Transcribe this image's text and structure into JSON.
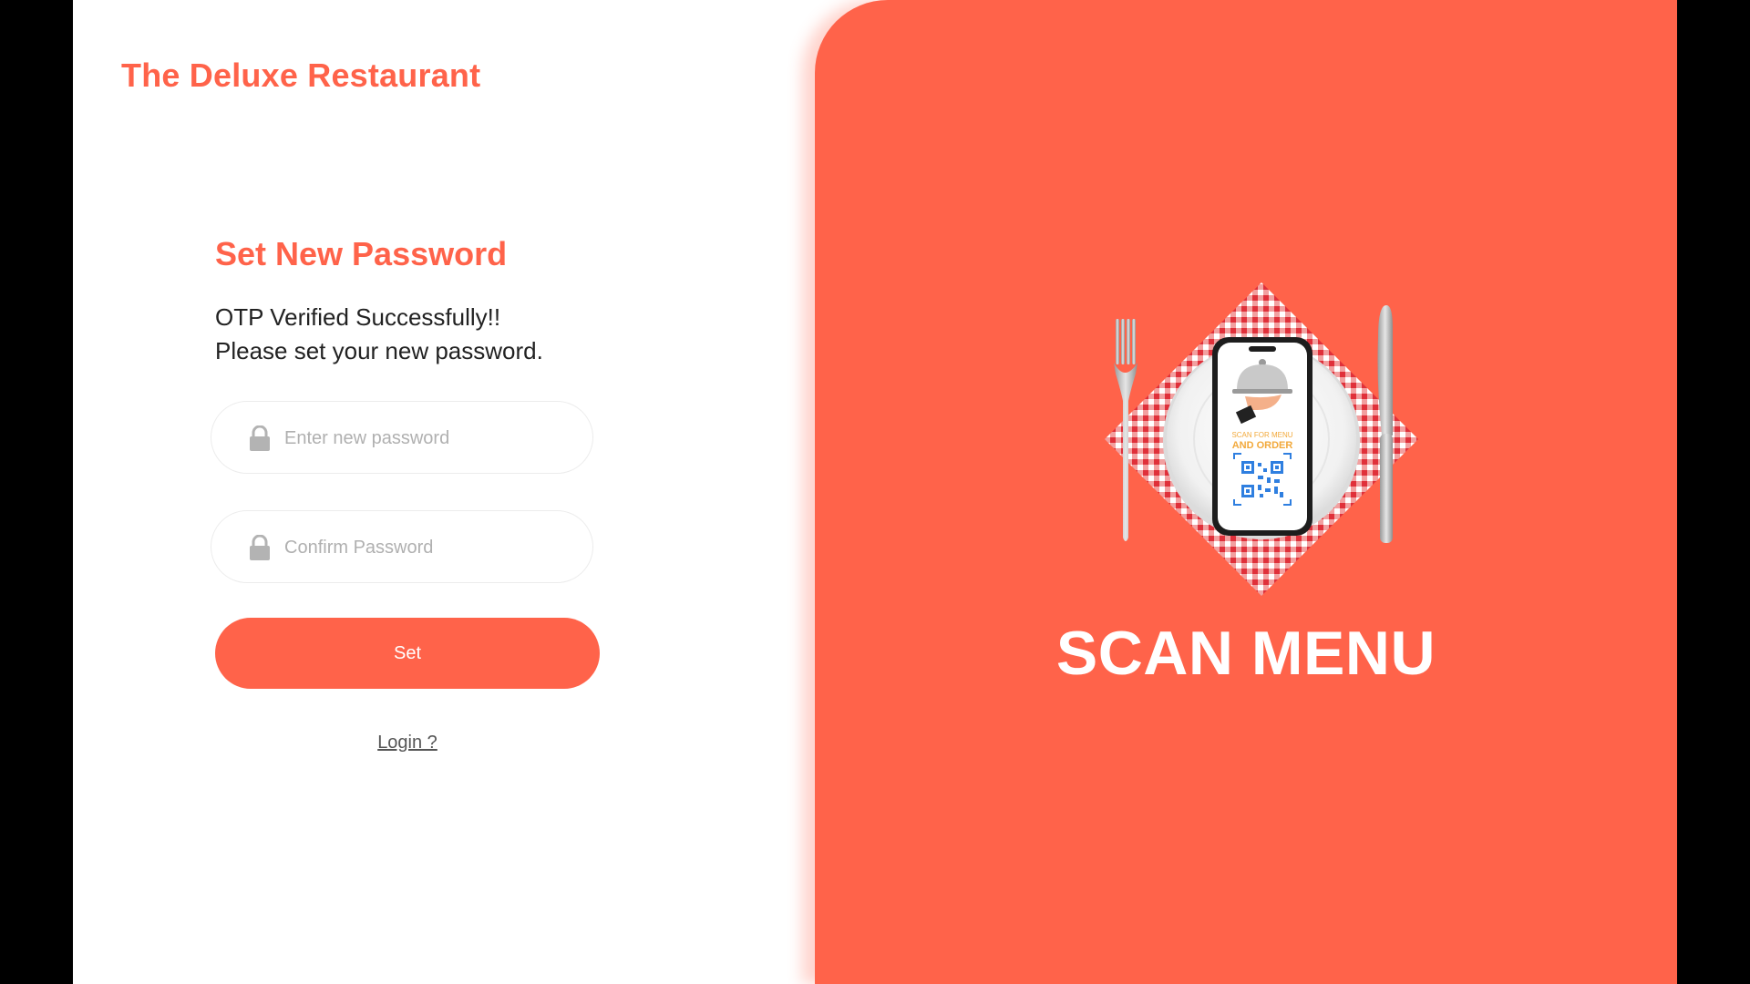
{
  "brand": {
    "name": "The Deluxe Restaurant"
  },
  "form": {
    "title": "Set New Password",
    "message_line1": "OTP Verified Successfully!!",
    "message_line2": "Please set your new password.",
    "new_password": {
      "placeholder": "Enter new password",
      "value": ""
    },
    "confirm_password": {
      "placeholder": "Confirm Password",
      "value": ""
    },
    "submit_label": "Set",
    "login_link": "Login ?"
  },
  "promo": {
    "title": "SCAN MENU",
    "phone_text_line1": "SCAN FOR MENU",
    "phone_text_line2": "AND ORDER"
  },
  "colors": {
    "accent": "#ff634a",
    "text_dark": "#222222",
    "placeholder": "#b0b0b0"
  },
  "icons": [
    "lock-icon",
    "fork-icon",
    "knife-icon",
    "plate-icon",
    "phone-icon",
    "qr-code-icon",
    "cloche-icon"
  ]
}
